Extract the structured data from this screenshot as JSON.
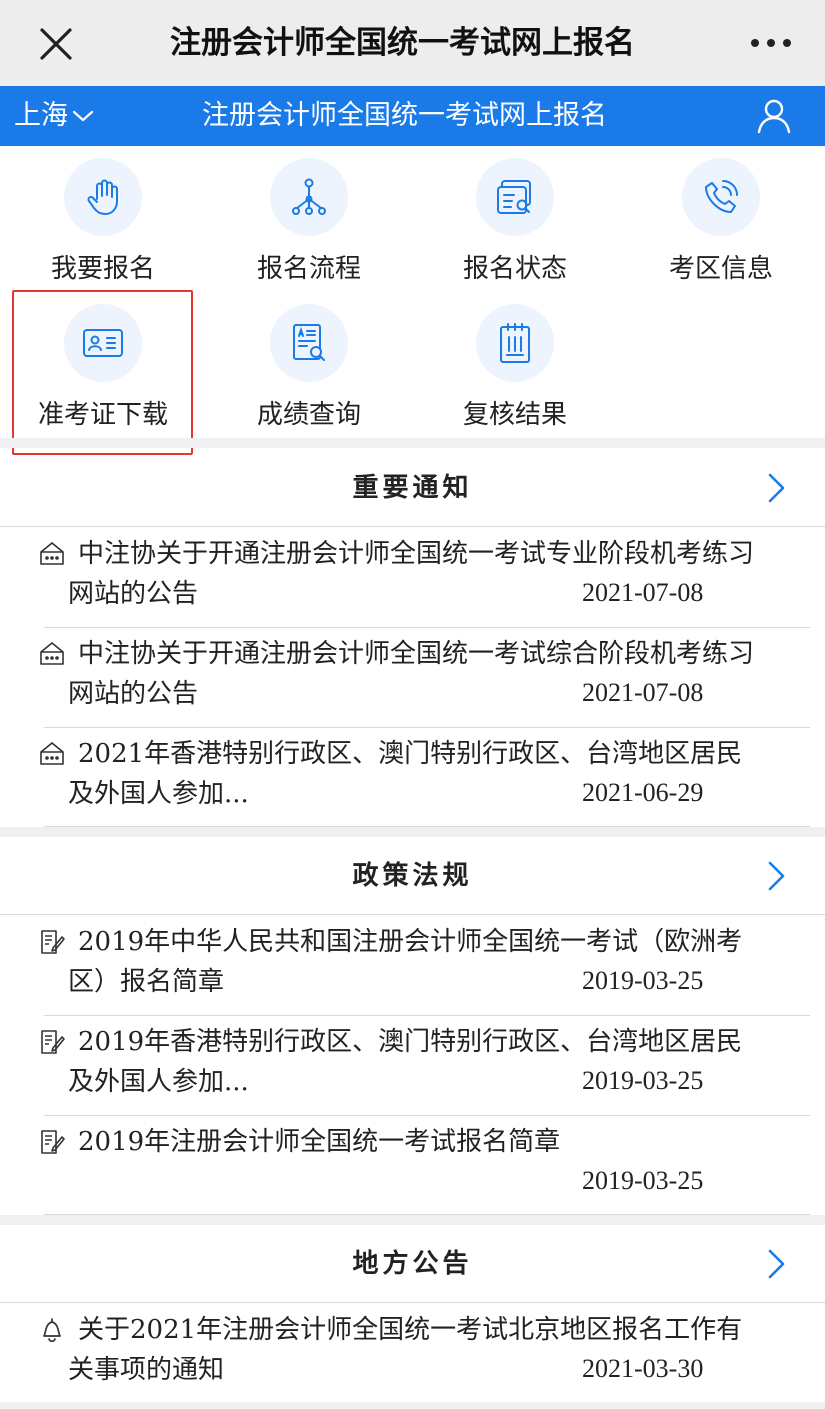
{
  "topbar": {
    "title": "注册会计师全国统一考试网上报名"
  },
  "header": {
    "region": "上海",
    "title": "注册会计师全国统一考试网上报名"
  },
  "grid": [
    {
      "label": "我要报名",
      "icon": "hand-icon"
    },
    {
      "label": "报名流程",
      "icon": "flow-icon"
    },
    {
      "label": "报名状态",
      "icon": "status-icon"
    },
    {
      "label": "考区信息",
      "icon": "phone-icon"
    },
    {
      "label": "准考证下载",
      "icon": "id-card-icon"
    },
    {
      "label": "成绩查询",
      "icon": "score-search-icon"
    },
    {
      "label": "复核结果",
      "icon": "clipboard-icon"
    }
  ],
  "sections": [
    {
      "title": "重要通知",
      "items": [
        {
          "title": "中注协关于开通注册会计师全国统一考试专业阶段机考练习网站的公告",
          "date": "2021-07-08"
        },
        {
          "title": "中注协关于开通注册会计师全国统一考试综合阶段机考练习网站的公告",
          "date": "2021-07-08"
        },
        {
          "title": "2021年香港特别行政区、澳门特别行政区、台湾地区居民及外国人参加...",
          "date": "2021-06-29"
        }
      ]
    },
    {
      "title": "政策法规",
      "items": [
        {
          "title": "2019年中华人民共和国注册会计师全国统一考试（欧洲考区）报名简章",
          "date": "2019-03-25"
        },
        {
          "title": "2019年香港特别行政区、澳门特别行政区、台湾地区居民及外国人参加...",
          "date": "2019-03-25"
        },
        {
          "title": "2019年注册会计师全国统一考试报名简章",
          "date": "2019-03-25"
        }
      ]
    },
    {
      "title": "地方公告",
      "items": [
        {
          "title": "关于2021年注册会计师全国统一考试北京地区报名工作有关事项的通知",
          "date": "2021-03-30"
        }
      ]
    }
  ],
  "colors": {
    "brand": "#1a7be8",
    "highlight": "#e8342e",
    "icon_bg": "#edf4fd"
  }
}
